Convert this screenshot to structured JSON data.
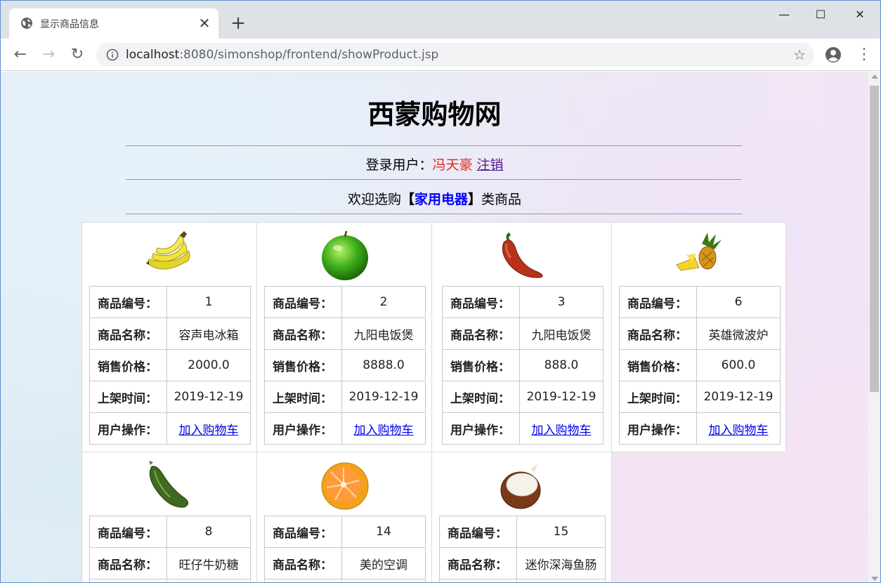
{
  "browser": {
    "tab_title": "显示商品信息",
    "url_host": "localhost",
    "url_path": ":8080/simonshop/frontend/showProduct.jsp"
  },
  "page": {
    "site_title": "西蒙购物网",
    "login_prefix": "登录用户：",
    "username": "冯天豪",
    "logout_label": "注销",
    "welcome_prefix": "欢迎选购",
    "bracket_open": "【",
    "category": "家用电器",
    "bracket_close": "】",
    "welcome_suffix": "类商品"
  },
  "labels": {
    "id": "商品编号：",
    "name": "商品名称：",
    "price": "销售价格：",
    "date": "上架时间：",
    "action": "用户操作："
  },
  "products": [
    {
      "image": "banana-icon",
      "id": "1",
      "name": "容声电冰箱",
      "price": "2000.0",
      "date": "2019-12-19",
      "action": "加入购物车"
    },
    {
      "image": "apple-icon",
      "id": "2",
      "name": "九阳电饭煲",
      "price": "8888.0",
      "date": "2019-12-19",
      "action": "加入购物车"
    },
    {
      "image": "pepper-icon",
      "id": "3",
      "name": "九阳电饭煲",
      "price": "888.0",
      "date": "2019-12-19",
      "action": "加入购物车"
    },
    {
      "image": "pineapple-icon",
      "id": "6",
      "name": "英雄微波炉",
      "price": "600.0",
      "date": "2019-12-19",
      "action": "加入购物车"
    },
    {
      "image": "zucchini-icon",
      "id": "8",
      "name": "旺仔牛奶糖"
    },
    {
      "image": "orange-icon",
      "id": "14",
      "name": "美的空调"
    },
    {
      "image": "coconut-icon",
      "id": "15",
      "name": "迷你深海鱼肠"
    }
  ]
}
